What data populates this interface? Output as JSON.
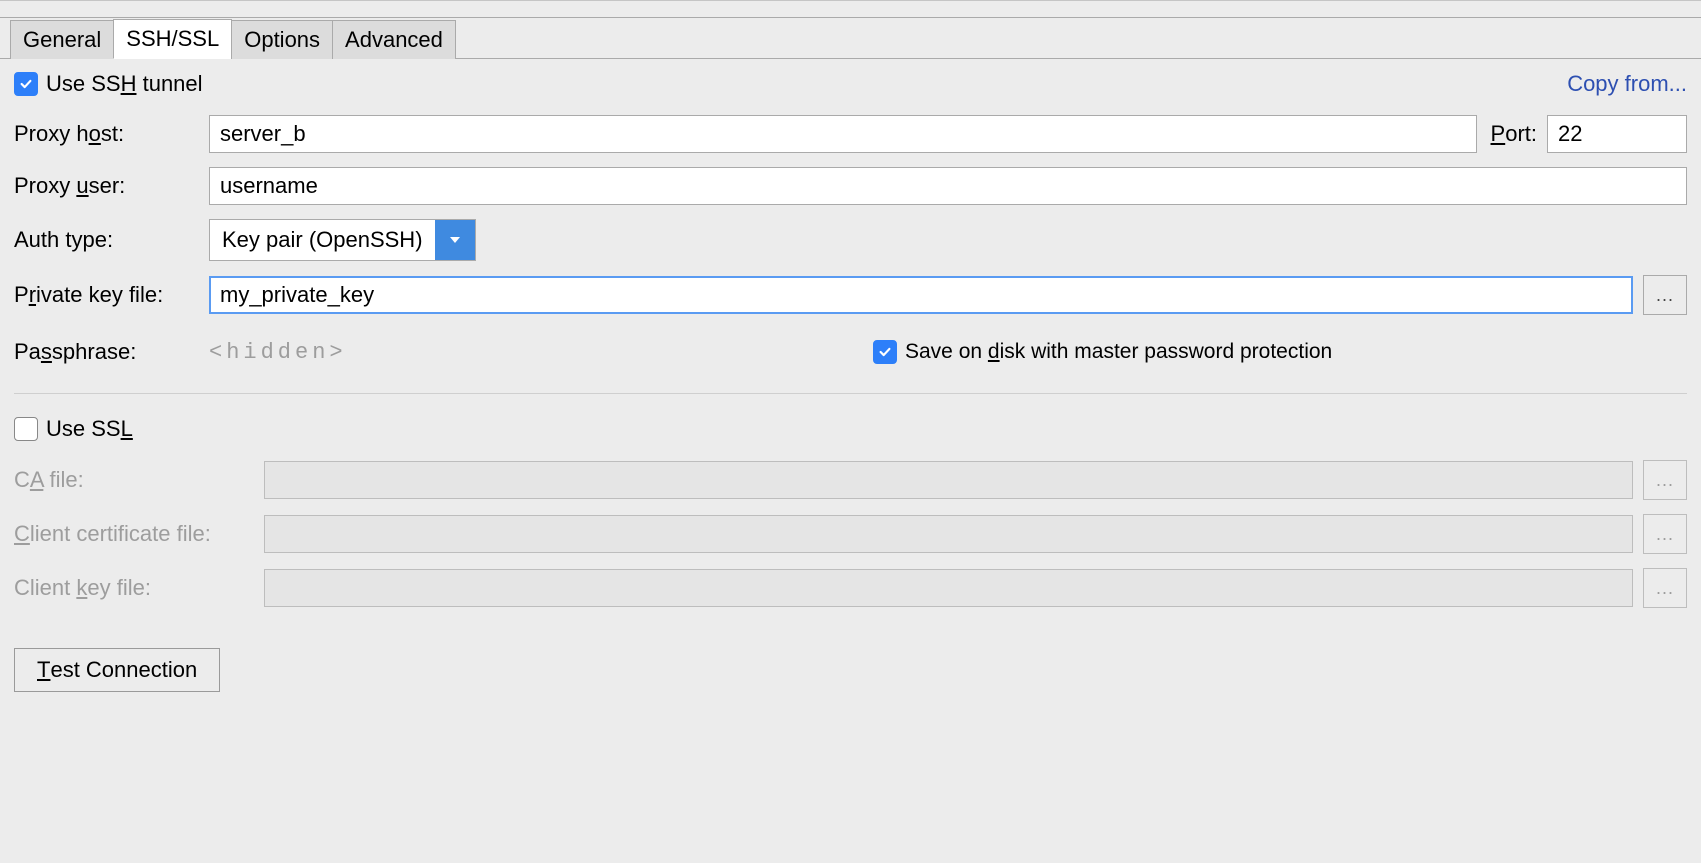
{
  "tabs": {
    "general": "General",
    "sshssl": "SSH/SSL",
    "options": "Options",
    "advanced": "Advanced"
  },
  "ssh": {
    "use_ssh_pre": "Use SS",
    "use_ssh_u": "H",
    "use_ssh_post": " tunnel",
    "copy_from": "Copy from...",
    "proxy_host_pre": "Proxy h",
    "proxy_host_u": "o",
    "proxy_host_post": "st:",
    "proxy_host_value": "server_b",
    "port_u": "P",
    "port_post": "ort:",
    "port_value": "22",
    "proxy_user_pre": "Proxy ",
    "proxy_user_u": "u",
    "proxy_user_post": "ser:",
    "proxy_user_value": "username",
    "auth_type_label": "Auth type:",
    "auth_type_value": "Key pair (OpenSSH)",
    "private_key_pre": "P",
    "private_key_u": "r",
    "private_key_post": "ivate key file:",
    "private_key_value": "my_private_key",
    "passphrase_pre": "Pa",
    "passphrase_u": "s",
    "passphrase_post": "sphrase:",
    "passphrase_placeholder": "<hidden>",
    "save_on_disk_pre": "Save on ",
    "save_on_disk_u": "d",
    "save_on_disk_post": "isk with master password protection"
  },
  "ssl": {
    "use_ssl_pre": "Use SS",
    "use_ssl_u": "L",
    "ca_file_pre": "C",
    "ca_file_u": "A",
    "ca_file_post": " file:",
    "client_cert_u": "C",
    "client_cert_post": "lient certificate file:",
    "client_key_pre": "Client ",
    "client_key_u": "k",
    "client_key_post": "ey file:"
  },
  "buttons": {
    "browse": "...",
    "test_u": "T",
    "test_post": "est Connection"
  },
  "ssl_label_width": "250px"
}
